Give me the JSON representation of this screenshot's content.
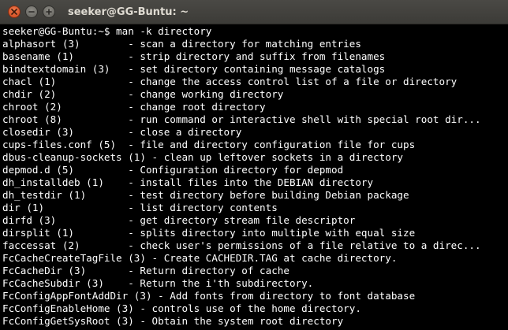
{
  "window": {
    "title": "seeker@GG-Buntu: ~"
  },
  "terminal": {
    "prompt": "seeker@GG-Buntu:~$ man -k directory",
    "lines": [
      "alphasort (3)        - scan a directory for matching entries",
      "basename (1)         - strip directory and suffix from filenames",
      "bindtextdomain (3)   - set directory containing message catalogs",
      "chacl (1)            - change the access control list of a file or directory",
      "chdir (2)            - change working directory",
      "chroot (2)           - change root directory",
      "chroot (8)           - run command or interactive shell with special root dir...",
      "closedir (3)         - close a directory",
      "cups-files.conf (5)  - file and directory configuration file for cups",
      "dbus-cleanup-sockets (1) - clean up leftover sockets in a directory",
      "depmod.d (5)         - Configuration directory for depmod",
      "dh_installdeb (1)    - install files into the DEBIAN directory",
      "dh_testdir (1)       - test directory before building Debian package",
      "dir (1)              - list directory contents",
      "dirfd (3)            - get directory stream file descriptor",
      "dirsplit (1)         - splits directory into multiple with equal size",
      "faccessat (2)        - check user's permissions of a file relative to a direc...",
      "FcCacheCreateTagFile (3) - Create CACHEDIR.TAG at cache directory.",
      "FcCacheDir (3)       - Return directory of cache",
      "FcCacheSubdir (3)    - Return the i'th subdirectory.",
      "FcConfigAppFontAddDir (3) - Add fonts from directory to font database",
      "FcConfigEnableHome (3) - controls use of the home directory.",
      "FcConfigGetSysRoot (3) - Obtain the system root directory"
    ]
  },
  "icons": {
    "close": "close-icon",
    "minimize": "minimize-icon",
    "maximize": "maximize-icon"
  },
  "colors": {
    "titlebar": "#3c3b37",
    "close_button": "#e05a2b",
    "terminal_bg": "#000000",
    "terminal_fg": "#ffffff"
  }
}
